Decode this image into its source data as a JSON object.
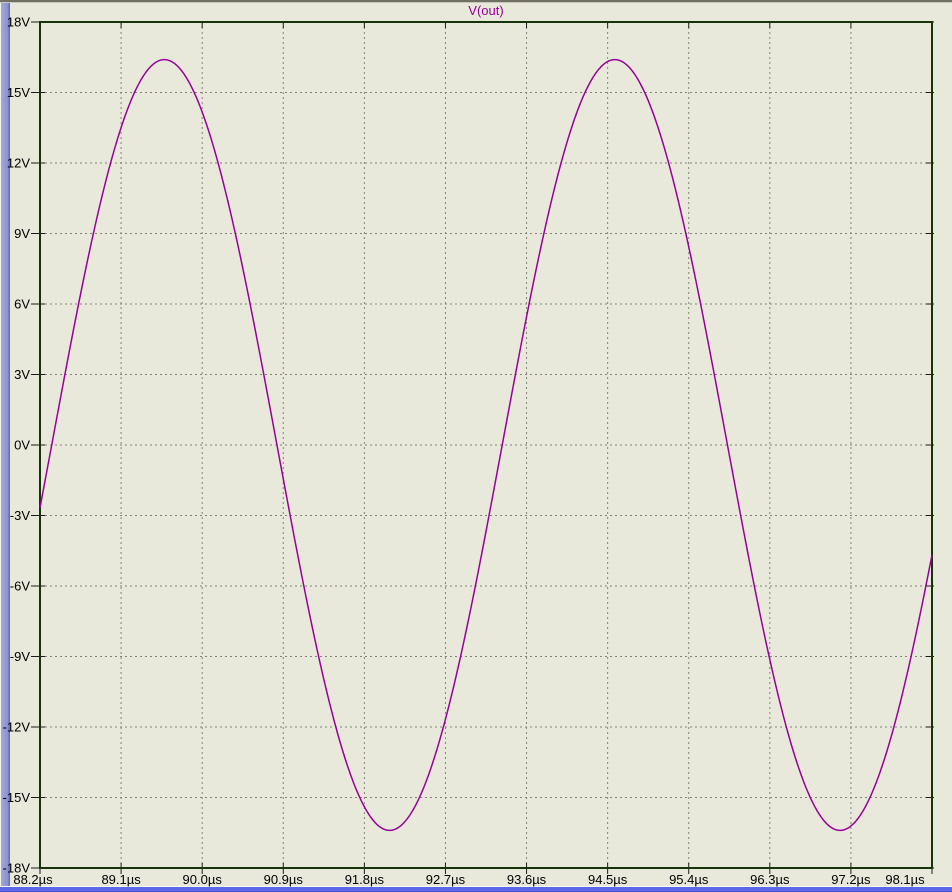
{
  "colors": {
    "background": "#e8e9da",
    "plot_border": "#16330a",
    "grid": "#82827a",
    "tick": "#1a1a1a",
    "tick_text": "#000000",
    "trace": "#990099",
    "title_text": "#990099",
    "left_border_strip": "#8890d0",
    "bottom_border_line": "#5b68ea",
    "top_edge_line": "#6f6f64"
  },
  "chart_data": {
    "type": "line",
    "title": "V(out)",
    "x_unit": "µs",
    "y_unit": "V",
    "x_range_us": [
      88.2,
      98.1
    ],
    "y_range_v": [
      -18,
      18
    ],
    "x_tick_step_us": 0.9,
    "y_tick_step_v": 3,
    "x_tick_labels": [
      "88.2µs",
      "89.1µs",
      "90.0µs",
      "90.9µs",
      "91.8µs",
      "92.7µs",
      "93.6µs",
      "94.5µs",
      "95.4µs",
      "96.3µs",
      "97.2µs",
      "98.1µs"
    ],
    "y_tick_labels": [
      "18V",
      "15V",
      "12V",
      "9V",
      "6V",
      "3V",
      "0V",
      "-3V",
      "-6V",
      "-9V",
      "-12V",
      "-15V",
      "-18V"
    ],
    "grid": "dashed",
    "legend_position": "top-center",
    "series": [
      {
        "name": "V(out)",
        "color": "#990099",
        "waveform": "sine",
        "amplitude_v": 16.4,
        "period_us": 5.0,
        "frequency_hz": 200000,
        "rising_zero_crossing_us": 88.33,
        "keypoints": [
          {
            "t_us": 88.2,
            "v": -2.7
          },
          {
            "t_us": 89.58,
            "v": 16.4
          },
          {
            "t_us": 90.83,
            "v": 0
          },
          {
            "t_us": 92.08,
            "v": -16.4
          },
          {
            "t_us": 93.33,
            "v": 0
          },
          {
            "t_us": 94.58,
            "v": 16.4
          },
          {
            "t_us": 95.83,
            "v": 0
          },
          {
            "t_us": 97.08,
            "v": -16.4
          },
          {
            "t_us": 98.1,
            "v": -4.7
          }
        ]
      }
    ]
  }
}
